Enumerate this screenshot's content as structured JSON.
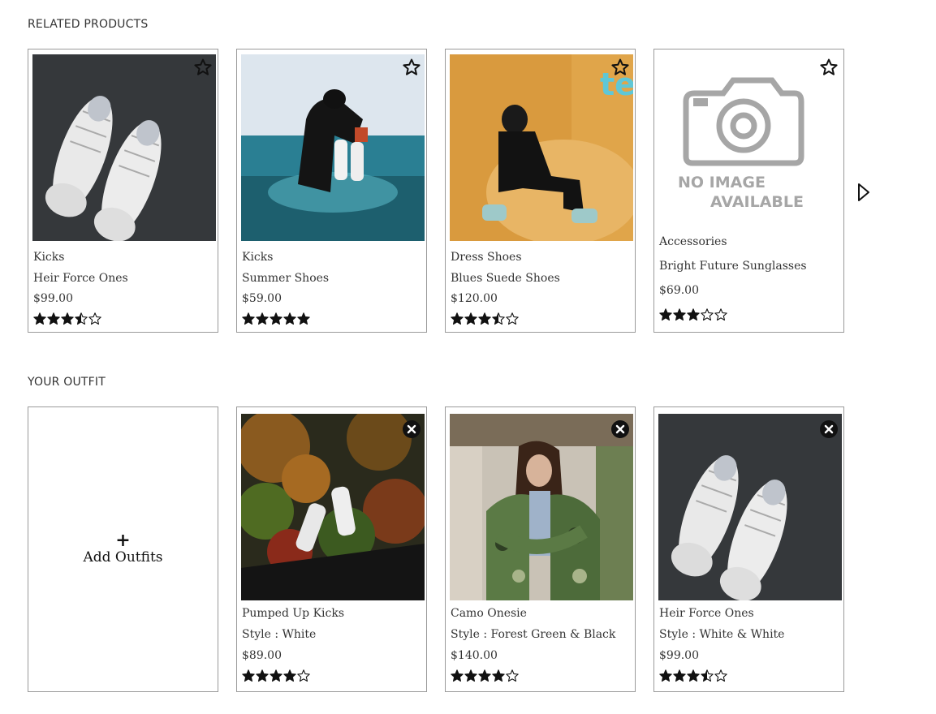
{
  "related": {
    "title": "RELATED PRODUCTS",
    "next_icon": "caret-right-icon",
    "products": [
      {
        "category": "Kicks",
        "name": "Heir Force Ones",
        "price": "$99.00",
        "rating": 3.5,
        "image": "white-sneakers-photo"
      },
      {
        "category": "Kicks",
        "name": "Summer Shoes",
        "price": "$59.00",
        "rating": 5,
        "image": "person-in-sea-photo"
      },
      {
        "category": "Dress Shoes",
        "name": "Blues Suede Shoes",
        "price": "$120.00",
        "rating": 3.5,
        "image": "man-on-beanbag-photo"
      },
      {
        "category": "Accessories",
        "name": "Bright Future Sunglasses",
        "price": "$69.00",
        "rating": 3,
        "image": "no-image-placeholder",
        "placeholder_text": [
          "NO IMAGE",
          "AVAILABLE"
        ]
      }
    ]
  },
  "outfit": {
    "title": "YOUR OUTFIT",
    "add_plus": "+",
    "add_label": "Add Outfits",
    "items": [
      {
        "name": "Pumped Up Kicks",
        "style": "Style : White",
        "price": "$89.00",
        "rating": 4,
        "image": "feet-over-forest-photo"
      },
      {
        "name": "Camo Onesie",
        "style": "Style : Forest Green & Black",
        "price": "$140.00",
        "rating": 4,
        "image": "woman-camo-jacket-photo"
      },
      {
        "name": "Heir Force Ones",
        "style": "Style : White & White",
        "price": "$99.00",
        "rating": 3.5,
        "image": "white-sneakers-photo"
      }
    ]
  }
}
